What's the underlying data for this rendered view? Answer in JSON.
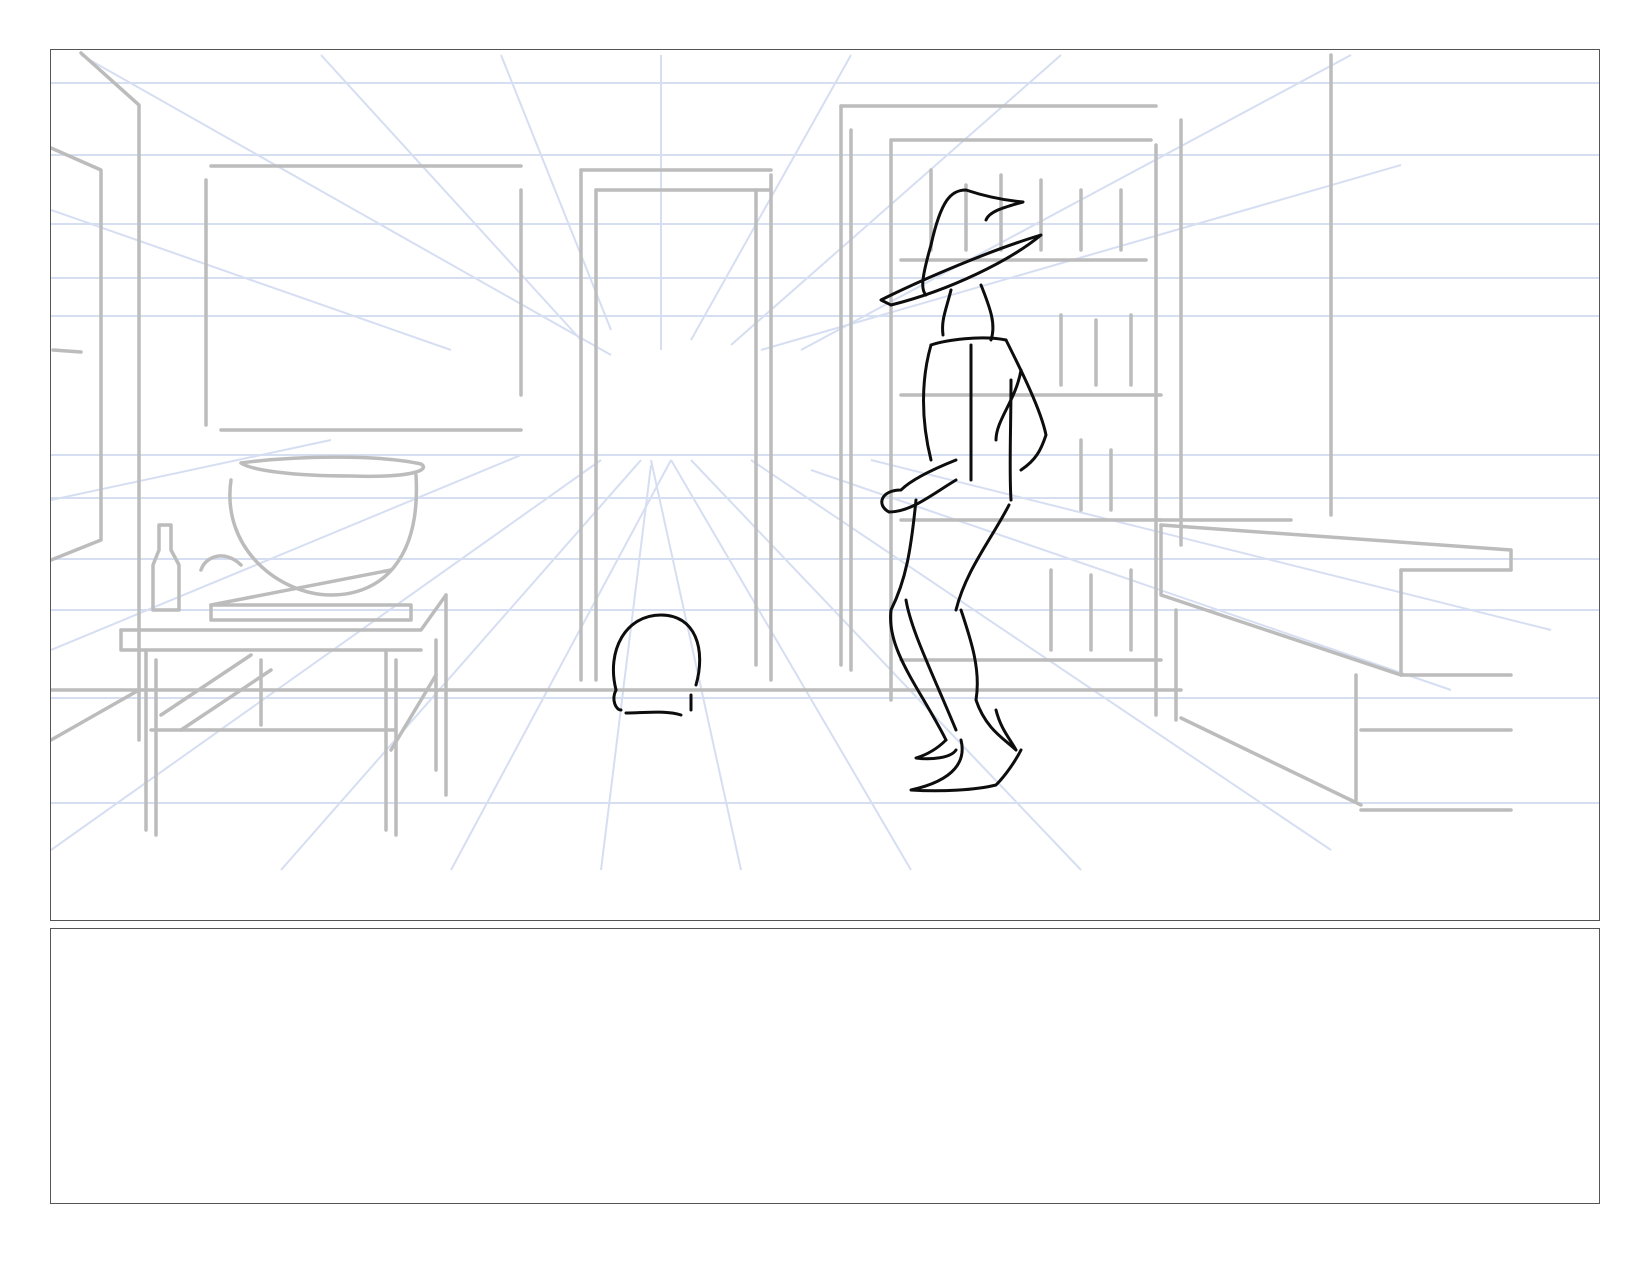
{
  "storyboard": {
    "panel_count": 1,
    "notes_text": ""
  },
  "colors": {
    "perspective_guides": "#d6def2",
    "rough_sketch": "#bcbcbc",
    "ink_lines": "#0d0d0d",
    "frame_border": "#555555"
  },
  "scene_elements": [
    "perspective-grid",
    "window",
    "doorway",
    "bookshelf",
    "side-table",
    "bowl",
    "bottle",
    "counter",
    "figure-in-hat",
    "head-sketch"
  ]
}
